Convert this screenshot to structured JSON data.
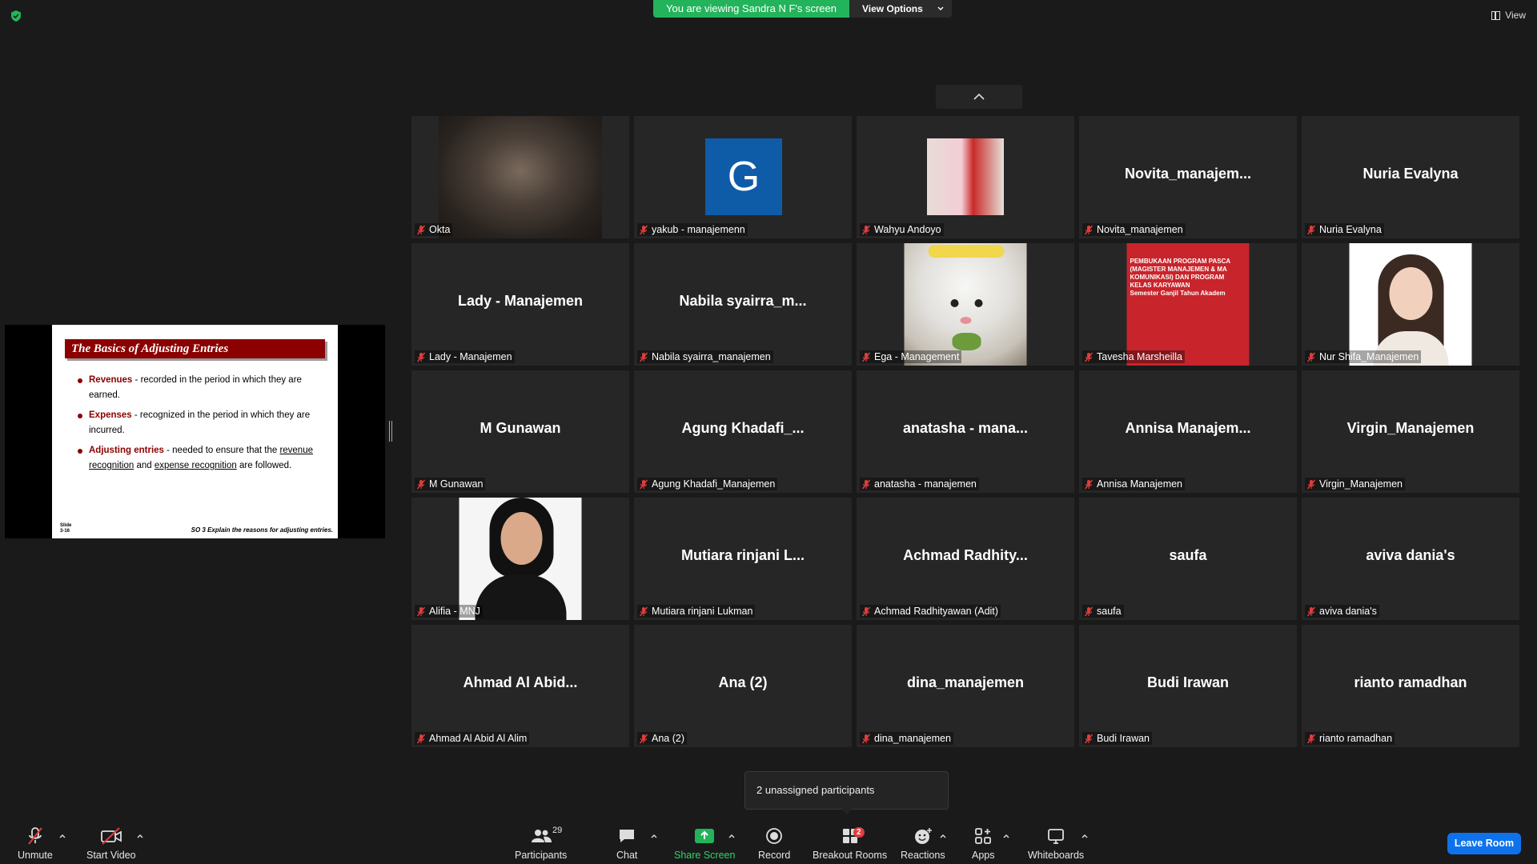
{
  "banner": {
    "viewing": "You are viewing Sandra N F's screen",
    "view_options": "View Options"
  },
  "view_button": "View",
  "slide": {
    "title": "The Basics of Adjusting Entries",
    "bullets": [
      {
        "term": "Revenues",
        "text": " - recorded in the period in which they are earned."
      },
      {
        "term": "Expenses",
        "text": " - recognized in the period in which they are incurred."
      },
      {
        "term": "Adjusting entries",
        "text": " - needed to ensure that the ",
        "link1": "revenue recognition",
        "mid": " and ",
        "link2": "expense recognition",
        "end": " are followed."
      }
    ],
    "footer_left": "Slide\n3-16",
    "footer_right": "SO 3  Explain the reasons for adjusting entries."
  },
  "participants": [
    {
      "display": "",
      "label": "Okta",
      "media": "video"
    },
    {
      "display": "",
      "label": "yakub - manajemenn",
      "media": "avatar",
      "avatar_letter": "G"
    },
    {
      "display": "",
      "label": "Wahyu Andoyo",
      "media": "couple"
    },
    {
      "display": "Novita_manajem...",
      "label": "Novita_manajemen"
    },
    {
      "display": "Nuria Evalyna",
      "label": "Nuria Evalyna"
    },
    {
      "display": "Lady - Manajemen",
      "label": "Lady - Manajemen"
    },
    {
      "display": "Nabila  syairra_m...",
      "label": "Nabila syairra_manajemen"
    },
    {
      "display": "",
      "label": "Ega - Management",
      "media": "hamster"
    },
    {
      "display": "",
      "label": "Tavesha Marsheilla",
      "media": "poster",
      "poster_lines": [
        "PEMBUKAAN PROGRAM PASCA",
        "(MAGISTER MANAJEMEN & MA",
        "KOMUNIKASI) DAN PROGRAM",
        "KELAS KARYAWAN",
        "Semester Ganjil Tahun Akadem"
      ]
    },
    {
      "display": "",
      "label": "Nur Shifa_Manajemen",
      "media": "portrait"
    },
    {
      "display": "M Gunawan",
      "label": "M Gunawan"
    },
    {
      "display": "Agung  Khadafi_...",
      "label": "Agung Khadafi_Manajemen"
    },
    {
      "display": "anatasha  - mana...",
      "label": "anatasha - manajemen"
    },
    {
      "display": "Annisa  Manajem...",
      "label": "Annisa Manajemen"
    },
    {
      "display": "Virgin_Manajemen",
      "label": "Virgin_Manajemen"
    },
    {
      "display": "",
      "label": "Alifia - MNJ",
      "media": "hijab"
    },
    {
      "display": "Mutiara  rinjani  L...",
      "label": "Mutiara rinjani Lukman"
    },
    {
      "display": "Achmad  Radhity...",
      "label": "Achmad Radhityawan (Adit)"
    },
    {
      "display": "saufa",
      "label": "saufa"
    },
    {
      "display": "aviva dania's",
      "label": "aviva dania's"
    },
    {
      "display": "Ahmad  Al  Abid...",
      "label": "Ahmad Al Abid Al Alim"
    },
    {
      "display": "Ana (2)",
      "label": "Ana (2)"
    },
    {
      "display": "dina_manajemen",
      "label": "dina_manajemen"
    },
    {
      "display": "Budi Irawan",
      "label": "Budi Irawan"
    },
    {
      "display": "rianto ramadhan",
      "label": "rianto ramadhan"
    }
  ],
  "tooltip": "2 unassigned participants",
  "toolbar": {
    "unmute": "Unmute",
    "start_video": "Start Video",
    "participants": "Participants",
    "participant_count": "29",
    "chat": "Chat",
    "share_screen": "Share Screen",
    "record": "Record",
    "breakout_rooms": "Breakout Rooms",
    "breakout_badge": "2",
    "reactions": "Reactions",
    "apps": "Apps",
    "whiteboards": "Whiteboards",
    "leave": "Leave Room"
  },
  "colors": {
    "share_green": "#23b45b",
    "leave_blue": "#0e72ed",
    "slide_red": "#8b0000"
  }
}
